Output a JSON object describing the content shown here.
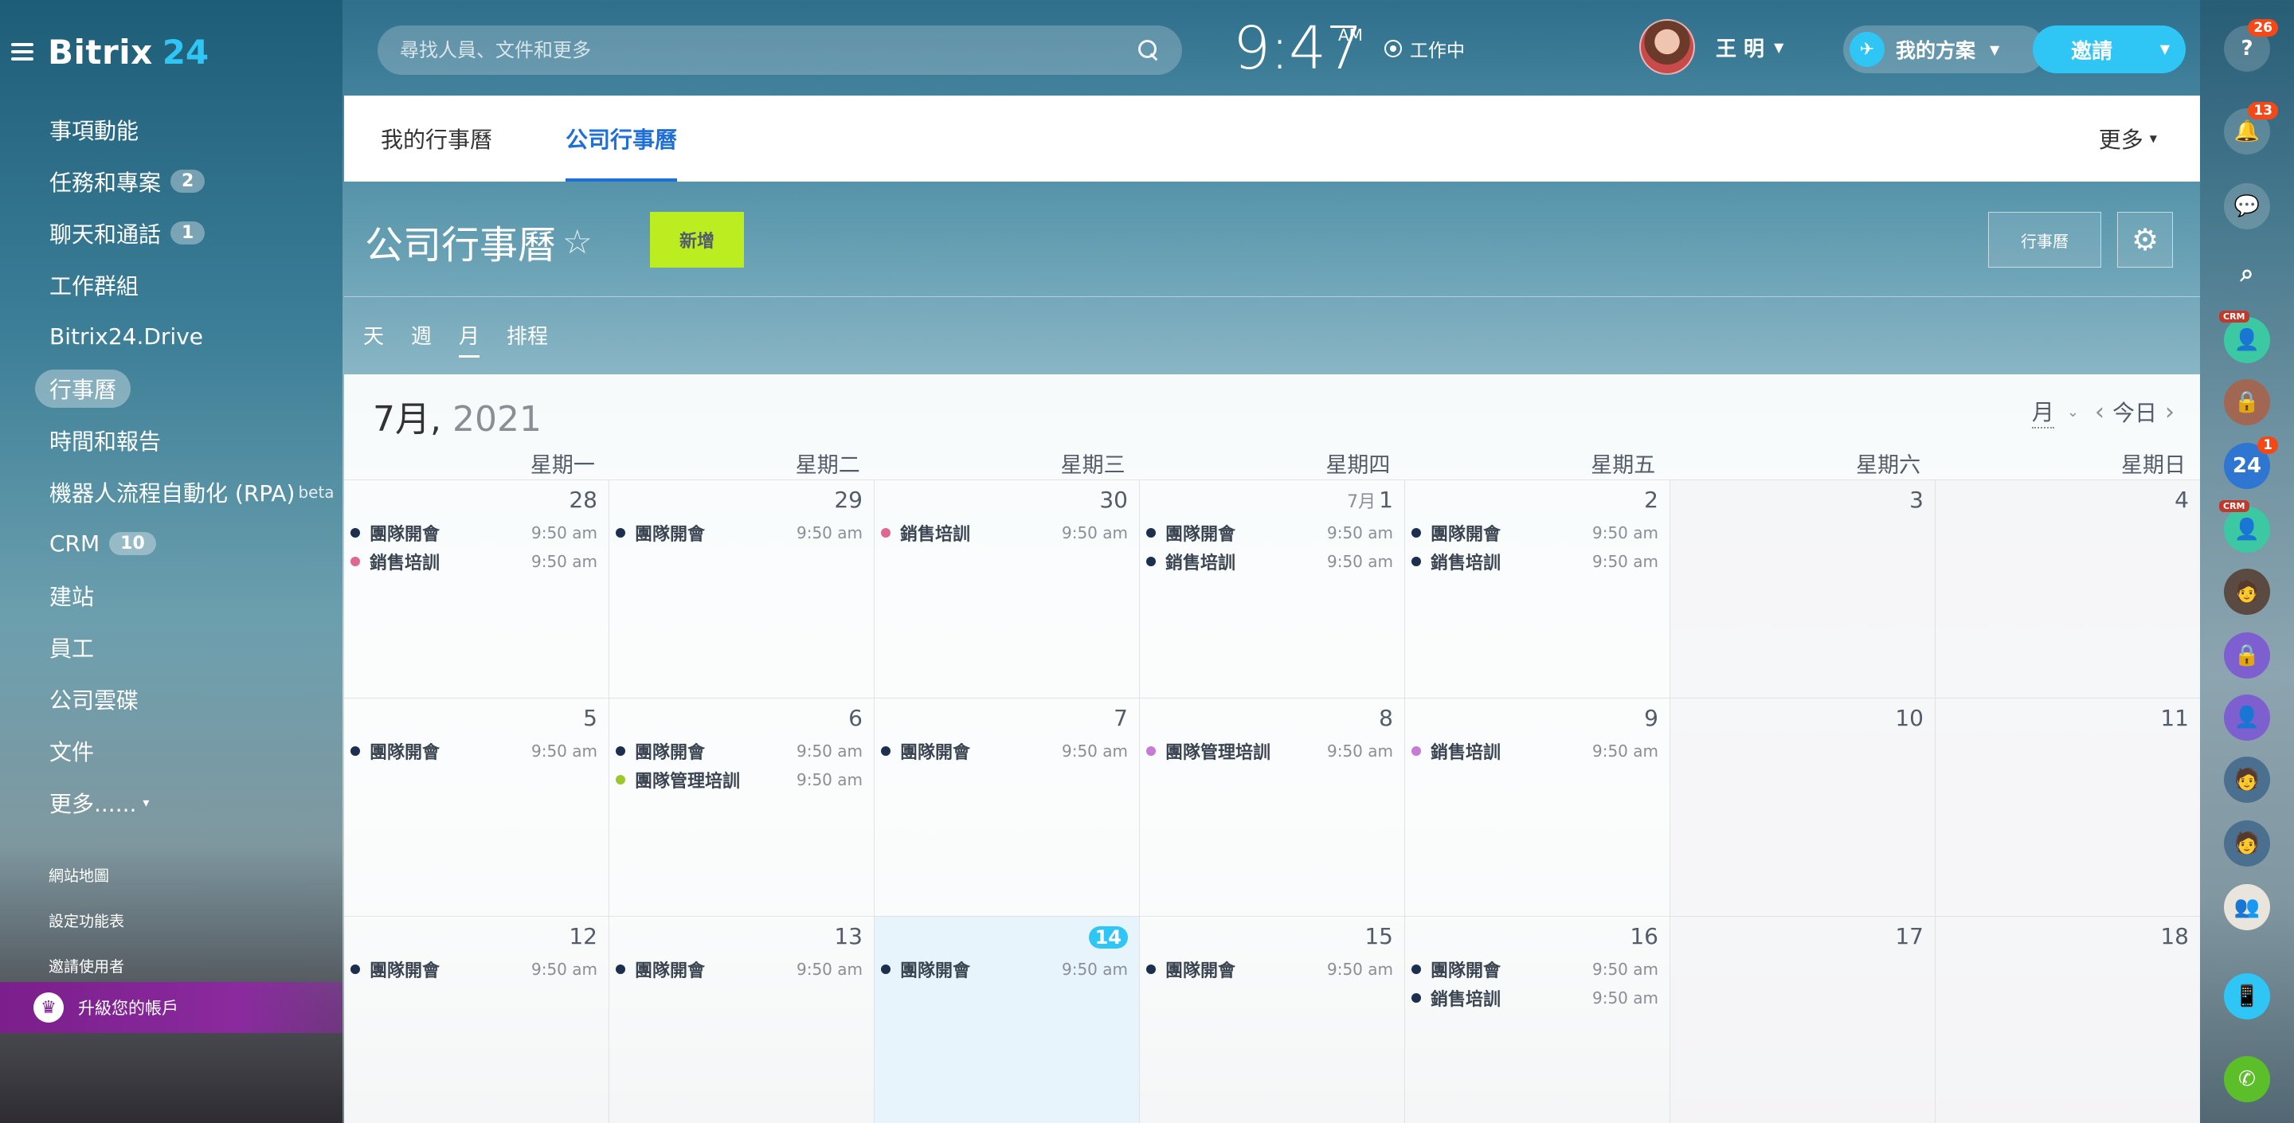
{
  "brand": {
    "name": "Bitrix",
    "num": "24"
  },
  "sidebar": {
    "items": [
      {
        "label": "事項動能",
        "badge": ""
      },
      {
        "label": "任務和專案",
        "badge": "2"
      },
      {
        "label": "聊天和通話",
        "badge": "1"
      },
      {
        "label": "工作群組",
        "badge": ""
      },
      {
        "label": "Bitrix24.Drive",
        "badge": ""
      },
      {
        "label": "行事曆",
        "badge": "",
        "active": true
      },
      {
        "label": "時間和報告",
        "badge": ""
      },
      {
        "label": "機器人流程自動化 (RPA)",
        "badge": "",
        "sup": "beta"
      },
      {
        "label": "CRM",
        "badge": "10"
      },
      {
        "label": "建站",
        "badge": ""
      },
      {
        "label": "員工",
        "badge": ""
      },
      {
        "label": "公司雲碟",
        "badge": ""
      },
      {
        "label": "文件",
        "badge": ""
      },
      {
        "label": "更多......",
        "badge": "",
        "caret": true
      }
    ],
    "sub_links": [
      "網站地圖",
      "設定功能表",
      "邀請使用者"
    ],
    "upgrade": "升級您的帳戶"
  },
  "topbar": {
    "search_placeholder": "尋找人員、文件和更多",
    "time": "9:47",
    "ampm": "AM",
    "work_status": "工作中",
    "user_name": "王 明",
    "plan": "我的方案",
    "invite": "邀請"
  },
  "rail": {
    "help_badge": "26",
    "bell_badge": "13",
    "b24_badge": "1",
    "crm_tag": "CRM",
    "b24_label": "24"
  },
  "tabs": {
    "my": "我的行事曆",
    "company": "公司行事曆",
    "more": "更多"
  },
  "calendar": {
    "title": "公司行事曆",
    "new_button": "新增",
    "calendars_button": "行事曆",
    "views": [
      "天",
      "週",
      "月",
      "排程"
    ],
    "active_view": "月",
    "month": "7月,",
    "year": "2021",
    "nav_month": "月",
    "nav_today": "今日",
    "weekdays": [
      "星期一",
      "星期二",
      "星期三",
      "星期四",
      "星期五",
      "星期六",
      "星期日"
    ],
    "colors": {
      "navy": "#1c2f4f",
      "pink": "#e0688e",
      "green": "#9dc82a",
      "violet": "#c77ad6"
    },
    "weeks": [
      [
        {
          "num": "28",
          "events": [
            {
              "t": "團隊開會",
              "time": "9:50 am",
              "c": "navy"
            },
            {
              "t": "銷售培訓",
              "time": "9:50 am",
              "c": "pink"
            }
          ]
        },
        {
          "num": "29",
          "events": [
            {
              "t": "團隊開會",
              "time": "9:50 am",
              "c": "navy"
            }
          ]
        },
        {
          "num": "30",
          "events": [
            {
              "t": "銷售培訓",
              "time": "9:50 am",
              "c": "pink"
            }
          ]
        },
        {
          "num": "1",
          "mon": "7月",
          "events": [
            {
              "t": "團隊開會",
              "time": "9:50 am",
              "c": "navy"
            },
            {
              "t": "銷售培訓",
              "time": "9:50 am",
              "c": "navy"
            }
          ]
        },
        {
          "num": "2",
          "events": [
            {
              "t": "團隊開會",
              "time": "9:50 am",
              "c": "navy"
            },
            {
              "t": "銷售培訓",
              "time": "9:50 am",
              "c": "navy"
            }
          ]
        },
        {
          "num": "3",
          "events": [],
          "weekend": true
        },
        {
          "num": "4",
          "events": [],
          "weekend": true
        }
      ],
      [
        {
          "num": "5",
          "events": [
            {
              "t": "團隊開會",
              "time": "9:50 am",
              "c": "navy"
            }
          ]
        },
        {
          "num": "6",
          "events": [
            {
              "t": "團隊開會",
              "time": "9:50 am",
              "c": "navy"
            },
            {
              "t": "團隊管理培訓",
              "time": "9:50 am",
              "c": "green"
            }
          ]
        },
        {
          "num": "7",
          "events": [
            {
              "t": "團隊開會",
              "time": "9:50 am",
              "c": "navy"
            }
          ]
        },
        {
          "num": "8",
          "events": [
            {
              "t": "團隊管理培訓",
              "time": "9:50 am",
              "c": "violet"
            }
          ]
        },
        {
          "num": "9",
          "events": [
            {
              "t": "銷售培訓",
              "time": "9:50 am",
              "c": "violet"
            }
          ]
        },
        {
          "num": "10",
          "events": [],
          "weekend": true
        },
        {
          "num": "11",
          "events": [],
          "weekend": true
        }
      ],
      [
        {
          "num": "12",
          "events": [
            {
              "t": "團隊開會",
              "time": "9:50 am",
              "c": "navy"
            }
          ]
        },
        {
          "num": "13",
          "events": [
            {
              "t": "團隊開會",
              "time": "9:50 am",
              "c": "navy"
            }
          ]
        },
        {
          "num": "14",
          "today": true,
          "events": [
            {
              "t": "團隊開會",
              "time": "9:50 am",
              "c": "navy"
            }
          ]
        },
        {
          "num": "15",
          "events": [
            {
              "t": "團隊開會",
              "time": "9:50 am",
              "c": "navy"
            }
          ]
        },
        {
          "num": "16",
          "events": [
            {
              "t": "團隊開會",
              "time": "9:50 am",
              "c": "navy"
            },
            {
              "t": "銷售培訓",
              "time": "9:50 am",
              "c": "navy"
            }
          ]
        },
        {
          "num": "17",
          "events": [],
          "weekend": true
        },
        {
          "num": "18",
          "events": [],
          "weekend": true
        }
      ]
    ]
  }
}
